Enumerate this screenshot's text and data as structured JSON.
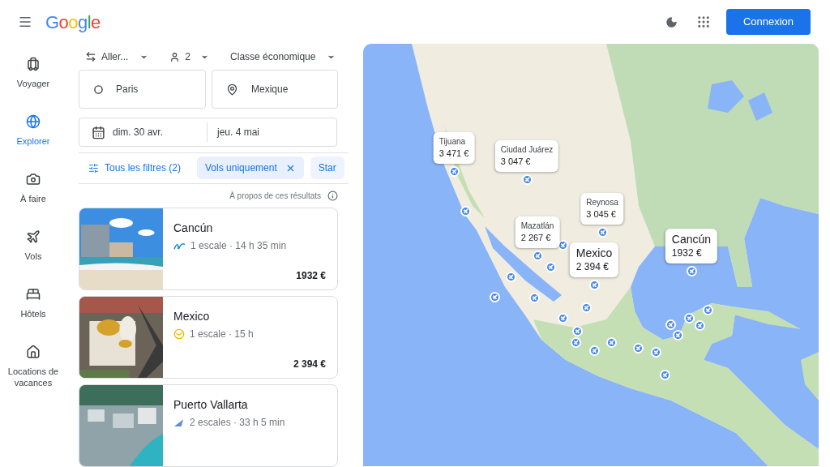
{
  "header": {
    "logo": "Google",
    "signin": "Connexion"
  },
  "sidebar": {
    "items": [
      {
        "label": "Voyager",
        "selected": false
      },
      {
        "label": "Explorer",
        "selected": true
      },
      {
        "label": "À faire",
        "selected": false
      },
      {
        "label": "Vols",
        "selected": false
      },
      {
        "label": "Hôtels",
        "selected": false
      },
      {
        "label": "Locations de vacances",
        "selected": false
      }
    ]
  },
  "search": {
    "trip_type": "Aller...",
    "passengers": "2",
    "cabin": "Classe économique",
    "origin": "Paris",
    "destination": "Mexique",
    "depart": "dim. 30 avr.",
    "return": "jeu. 4 mai"
  },
  "filters": {
    "all": "Tous les filtres (2)",
    "chips": [
      {
        "label": "Vols uniquement",
        "selected": true
      },
      {
        "label": "Star",
        "selected": false
      }
    ]
  },
  "about": "À propos de ces résultats",
  "results": [
    {
      "city": "Cancún",
      "details": "1 escale · 14 h 35 min",
      "price": "1932 €"
    },
    {
      "city": "Mexico",
      "details": "1 escale · 15 h",
      "price": "2 394 €"
    },
    {
      "city": "Puerto Vallarta",
      "details": "2 escales · 33 h 5 min"
    }
  ],
  "map": {
    "markers": [
      {
        "city": "Tijuana",
        "price": "3 471 €",
        "large": false
      },
      {
        "city": "Ciudad Juárez",
        "price": "3 047 €",
        "large": false
      },
      {
        "city": "Reynosa",
        "price": "3 045 €",
        "large": false
      },
      {
        "city": "Mazatlán",
        "price": "2 267 €",
        "large": false
      },
      {
        "city": "Mexico",
        "price": "2 394 €",
        "large": true
      },
      {
        "city": "Cancún",
        "price": "1932 €",
        "large": true
      }
    ]
  }
}
